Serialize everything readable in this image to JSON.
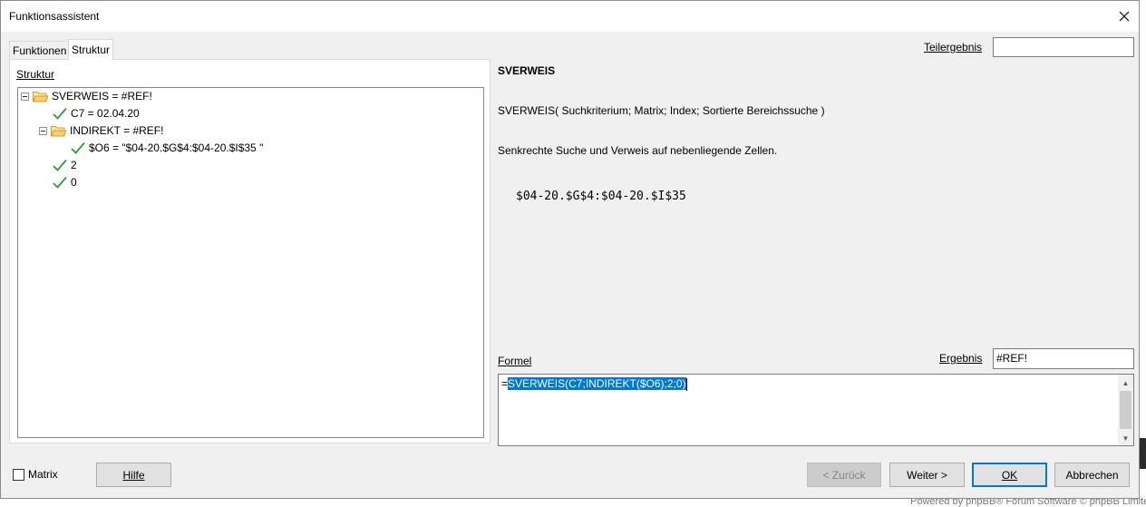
{
  "window": {
    "title": "Funktionsassistent"
  },
  "tabs": [
    {
      "label": "Funktionen",
      "active": false
    },
    {
      "label": "Struktur",
      "active": true
    }
  ],
  "structure": {
    "label": "Struktur",
    "tree": [
      {
        "text": "SVERWEIS = #REF!",
        "icon": "folder-icon",
        "expanded": true
      },
      {
        "text": "C7 = 02.04.20",
        "icon": "check-icon"
      },
      {
        "text": "INDIREKT = #REF!",
        "icon": "folder-icon",
        "expanded": true
      },
      {
        "text": "$O6 = \"$04-20.$G$4:$04-20.$I$35 \"",
        "icon": "check-icon"
      },
      {
        "text": "2",
        "icon": "check-icon"
      },
      {
        "text": "0",
        "icon": "check-icon"
      }
    ]
  },
  "partial_result": {
    "label": "Teilergebnis",
    "value": ""
  },
  "function_info": {
    "name": "SVERWEIS",
    "signature": "SVERWEIS( Suchkriterium; Matrix; Index; Sortierte Bereichssuche )",
    "description": "Senkrechte Suche und Verweis auf nebenliegende Zellen.",
    "argument_value": "$04-20.$G$4:$04-20.$I$35"
  },
  "formula": {
    "label": "Formel",
    "prefix": "=",
    "selected": "SVERWEIS(C7;INDIREKT($O6);2;0)"
  },
  "result": {
    "label": "Ergebnis",
    "value": "#REF!"
  },
  "matrix": {
    "label": "Matrix",
    "checked": false
  },
  "buttons": {
    "help": "Hilfe",
    "back": "< Zurück",
    "next": "Weiter >",
    "ok": "OK",
    "cancel": "Abbrechen"
  },
  "background": {
    "footer": "Powered by phpBB® Forum Software © phpBB Limite"
  },
  "colors": {
    "accent": "#0078d7",
    "check": "#2e9d3a",
    "folder": "#e8b04a"
  }
}
